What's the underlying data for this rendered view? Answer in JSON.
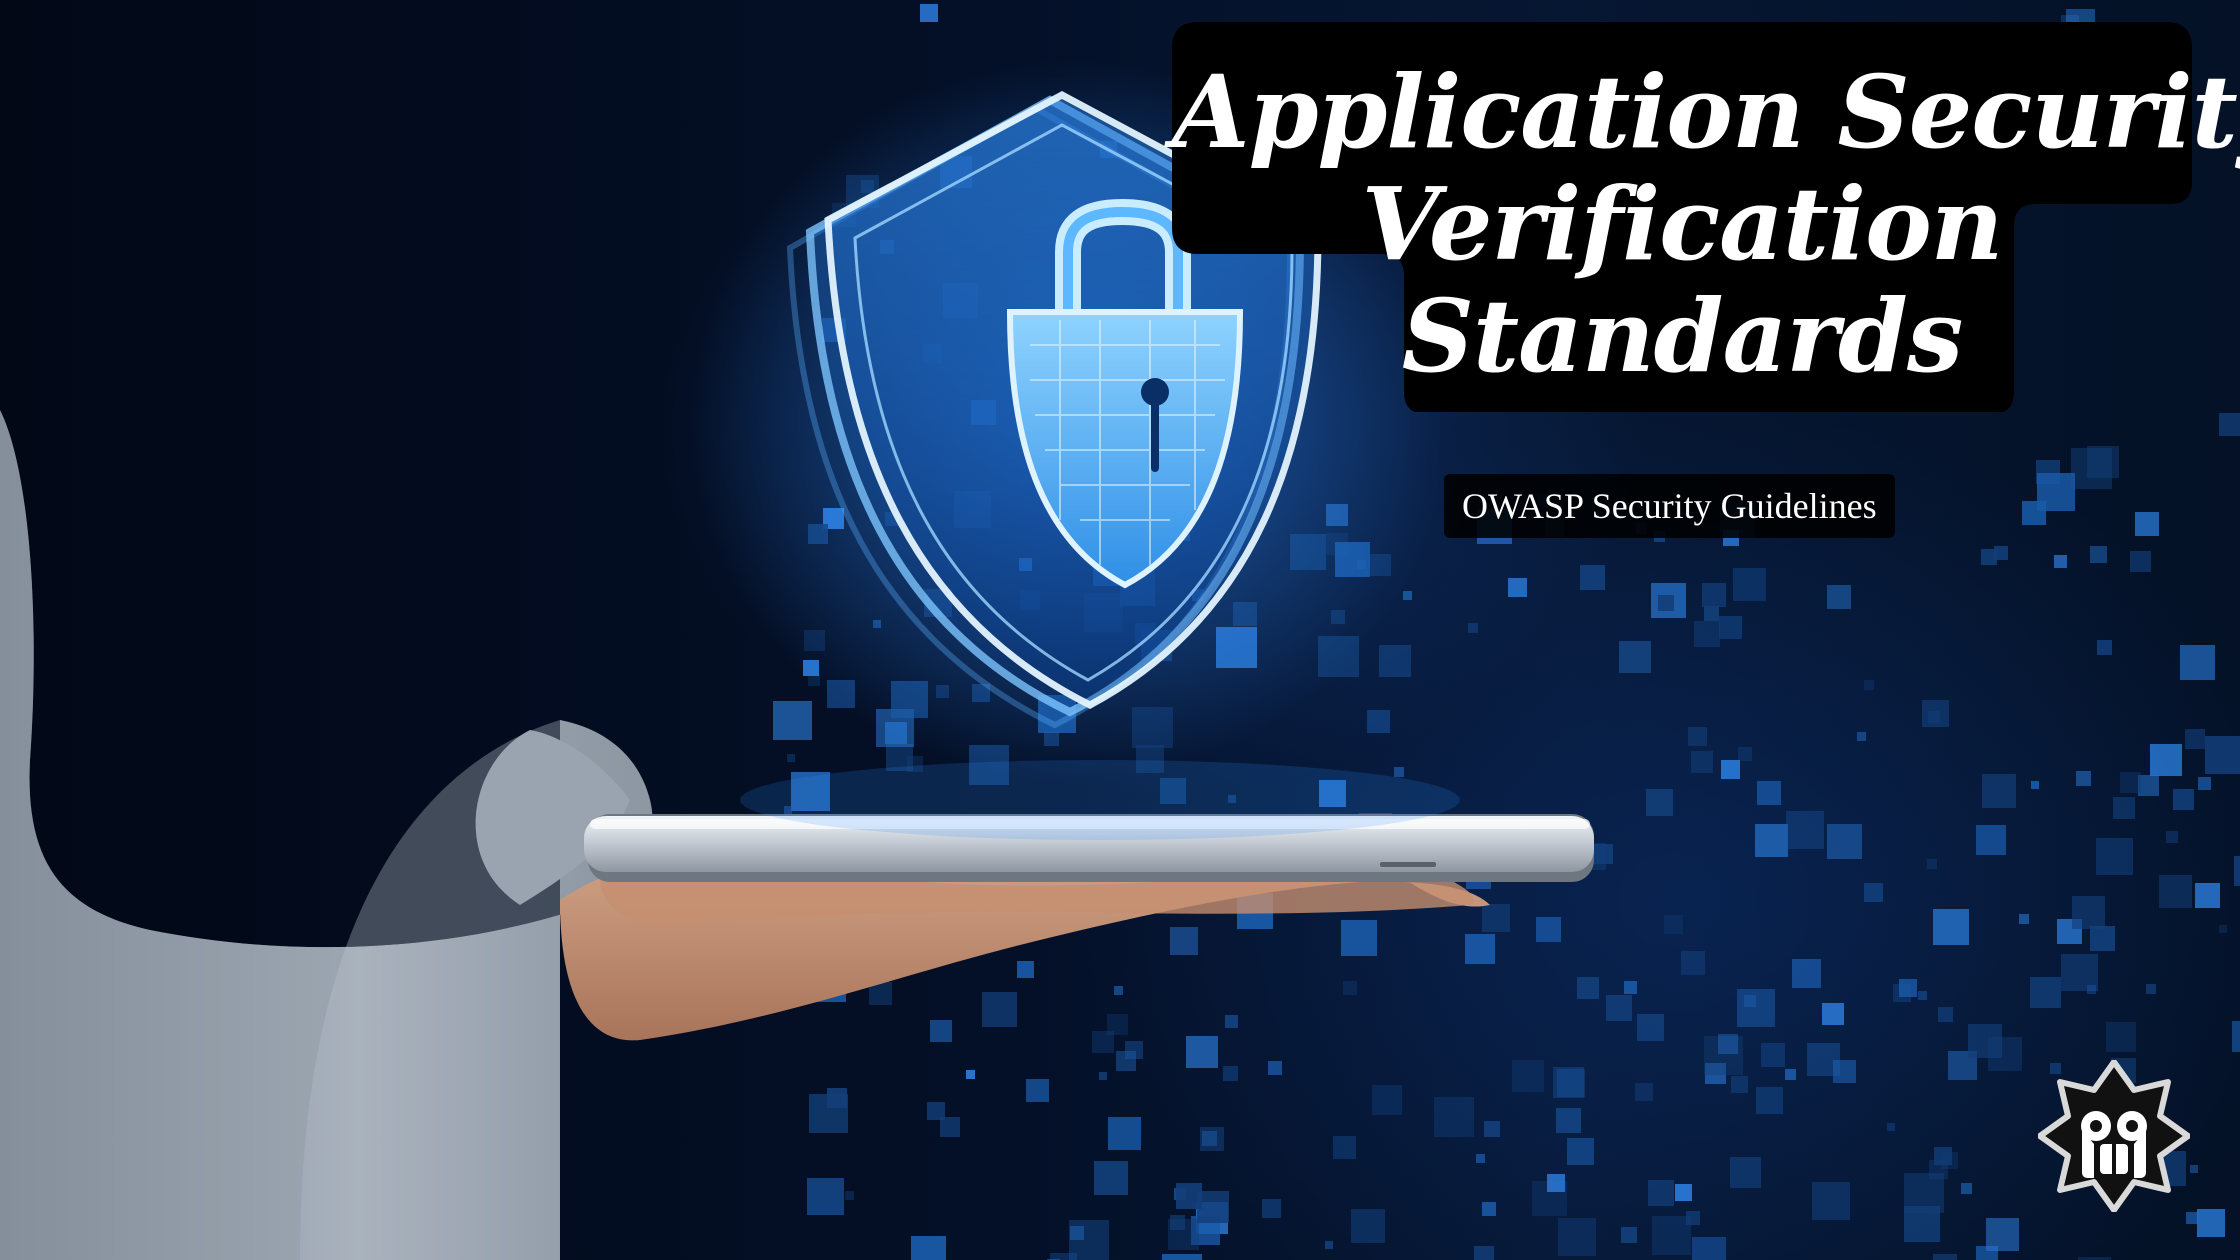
{
  "title": {
    "lines": [
      "Application Security",
      "Verification",
      "Standards"
    ]
  },
  "subtitle": "OWASP Security Guidelines",
  "colors": {
    "background": "#030b1a",
    "glow": "#3fa9ff",
    "shield_line": "#bfe6ff",
    "title_box": "#000000",
    "text": "#ffffff"
  },
  "icons": {
    "shield": "shield-icon",
    "padlock": "padlock-icon",
    "logo": "skull-emblem-icon"
  }
}
